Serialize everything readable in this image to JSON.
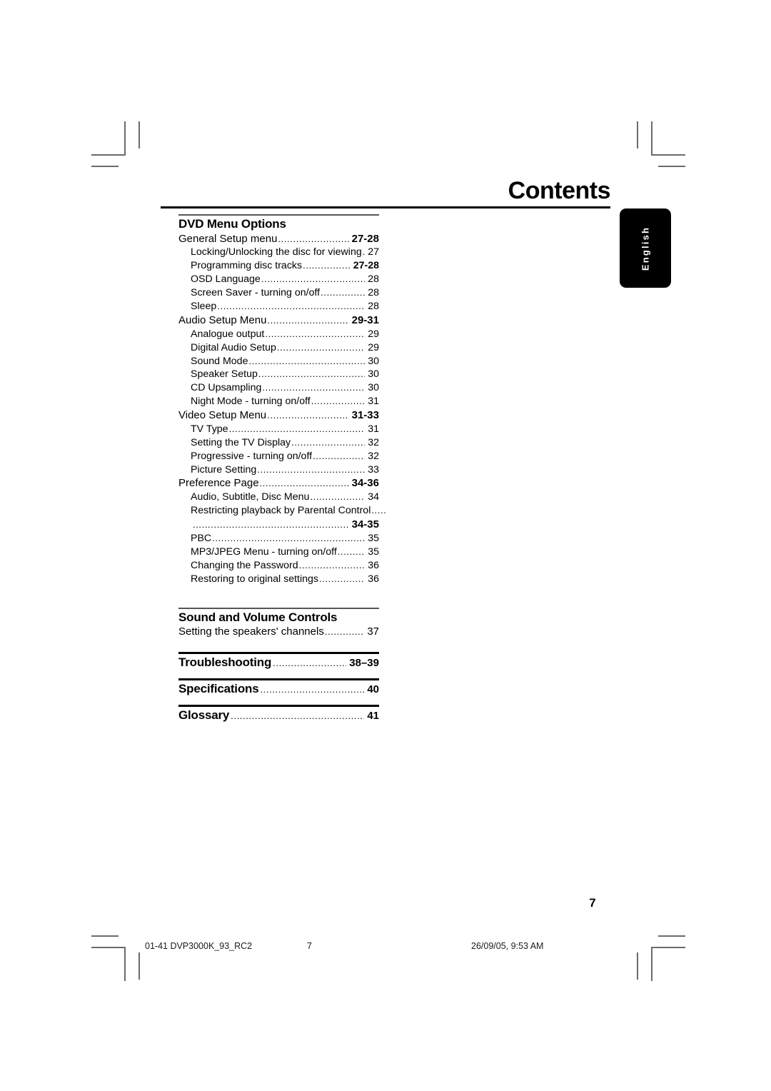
{
  "page": {
    "title": "Contents",
    "folio": "7",
    "language_tab": "English"
  },
  "toc": {
    "sections": [
      {
        "id": "dvd-menu-options",
        "title": "DVD Menu Options",
        "rule": "thin",
        "entries": [
          {
            "level": 1,
            "label": "General Setup menu",
            "page": "27-28"
          },
          {
            "level": 2,
            "label": "Locking/Unlocking the disc for viewing",
            "page": "27"
          },
          {
            "level": 2,
            "label": "Programming disc tracks",
            "page": "27-28",
            "bold_page": true
          },
          {
            "level": 2,
            "label": "OSD Language",
            "page": "28"
          },
          {
            "level": 2,
            "label": "Screen Saver - turning on/off",
            "page": "28"
          },
          {
            "level": 2,
            "label": "Sleep",
            "page": "28"
          },
          {
            "level": 1,
            "label": "Audio Setup Menu",
            "page": "29-31"
          },
          {
            "level": 2,
            "label": "Analogue output",
            "page": "29"
          },
          {
            "level": 2,
            "label": "Digital Audio Setup",
            "page": "29"
          },
          {
            "level": 2,
            "label": "Sound Mode",
            "page": "30"
          },
          {
            "level": 2,
            "label": "Speaker Setup",
            "page": "30"
          },
          {
            "level": 2,
            "label": "CD Upsampling",
            "page": "30"
          },
          {
            "level": 2,
            "label": "Night Mode - turning on/off",
            "page": "31"
          },
          {
            "level": 1,
            "label": "Video Setup Menu",
            "page": "31-33"
          },
          {
            "level": 2,
            "label": "TV Type",
            "page": "31"
          },
          {
            "level": 2,
            "label": "Setting the TV Display",
            "page": "32"
          },
          {
            "level": 2,
            "label": "Progressive - turning on/off",
            "page": "32"
          },
          {
            "level": 2,
            "label": "Picture Setting",
            "page": "33"
          },
          {
            "level": 1,
            "label": "Preference Page",
            "page": "34-36"
          },
          {
            "level": 2,
            "label": "Audio, Subtitle, Disc Menu",
            "page": "34"
          },
          {
            "level": 2,
            "label": "Restricting playback by Parental Control",
            "page": "",
            "trailing_dots": ".....",
            "wrap": true
          },
          {
            "level": 2,
            "continuation": true,
            "label": "",
            "page": "34-35"
          },
          {
            "level": 2,
            "label": "PBC",
            "page": "35"
          },
          {
            "level": 2,
            "label": "MP3/JPEG Menu - turning on/off",
            "page": "35"
          },
          {
            "level": 2,
            "label": "Changing the Password",
            "page": "36"
          },
          {
            "level": 2,
            "label": "Restoring to original settings",
            "page": "36"
          }
        ]
      },
      {
        "id": "sound-and-volume-controls",
        "title": "Sound and Volume Controls",
        "rule": "thin",
        "entries": [
          {
            "level": 1,
            "label": "Setting the speakers' channels",
            "page": "37",
            "plain_page": true
          }
        ]
      }
    ],
    "big_sections": [
      {
        "id": "troubleshooting",
        "label": "Troubleshooting",
        "page": "38–39"
      },
      {
        "id": "specifications",
        "label": "Specifications",
        "page": "40"
      },
      {
        "id": "glossary",
        "label": "Glossary",
        "page": "41"
      }
    ]
  },
  "footer": {
    "file": "01-41 DVP3000K_93_RC2",
    "page": "7",
    "date": "26/09/05, 9:53 AM"
  }
}
